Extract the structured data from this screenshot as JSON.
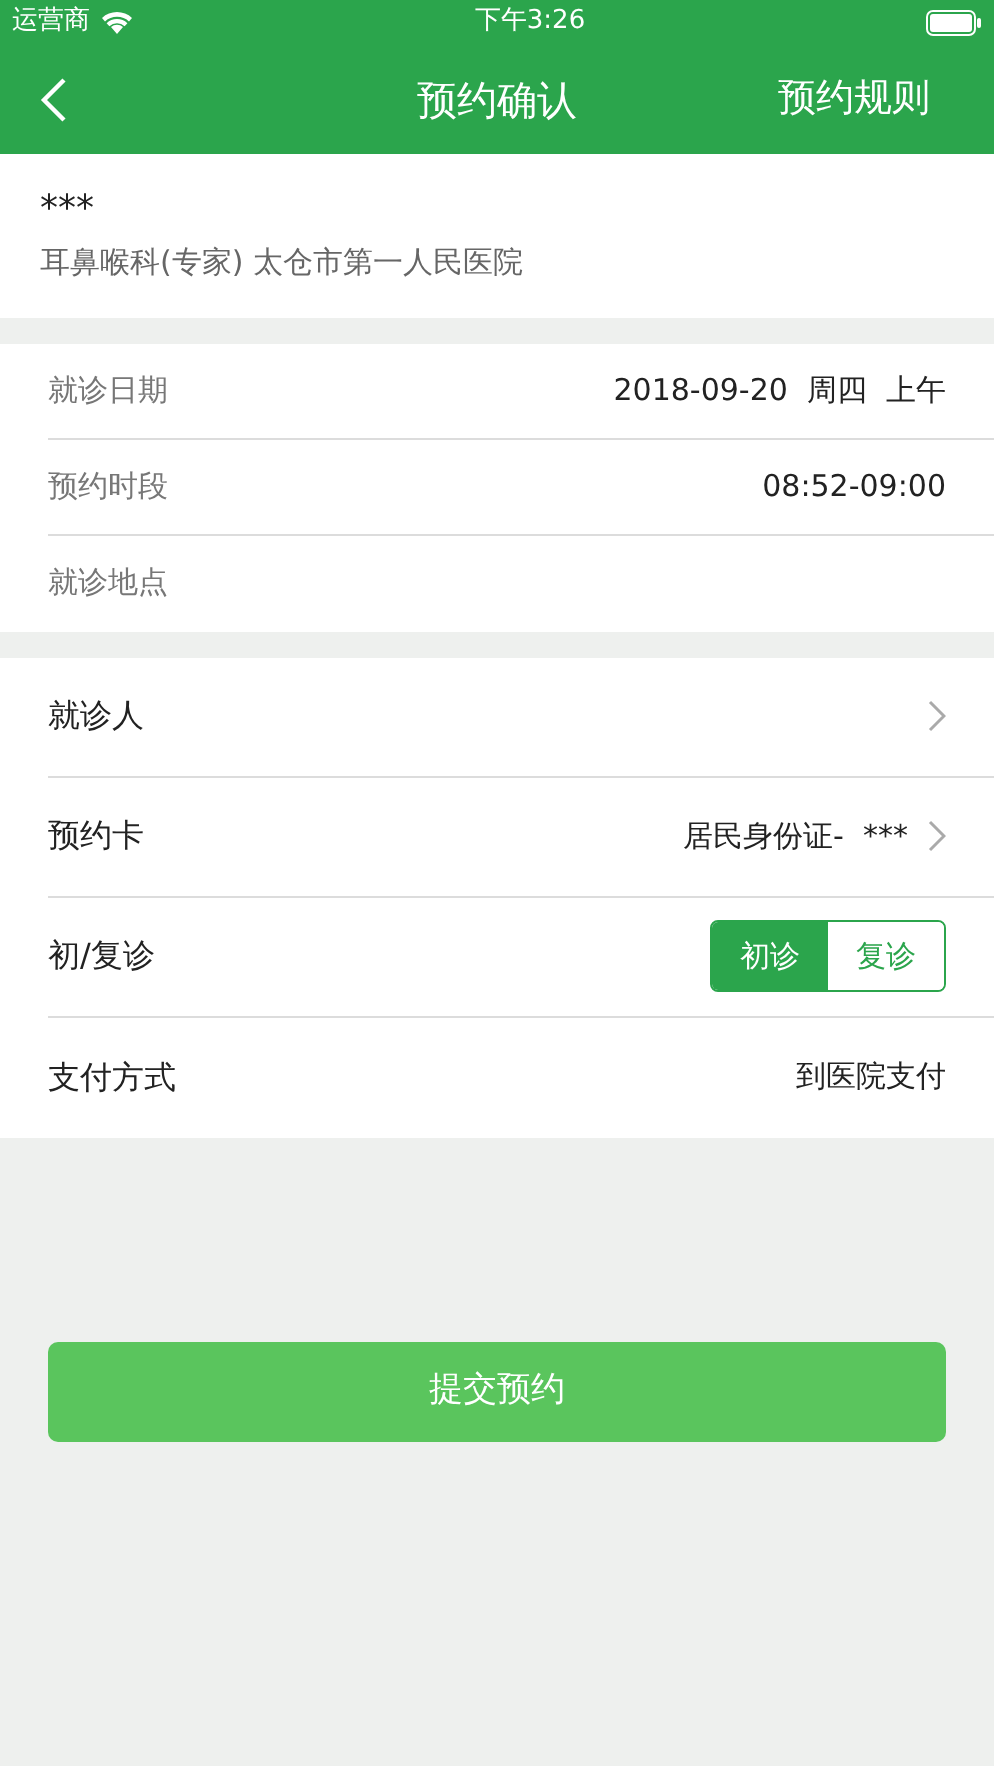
{
  "status_bar": {
    "carrier": "运营商",
    "time": "下午3:26"
  },
  "nav": {
    "title": "预约确认",
    "action": "预约规则"
  },
  "doctor": {
    "name": "***",
    "detail": "耳鼻喉科(专家) 太仓市第一人民医院"
  },
  "info_rows": [
    {
      "label": "就诊日期",
      "value": "2018-09-20  周四  上午"
    },
    {
      "label": "预约时段",
      "value": "08:52-09:00"
    },
    {
      "label": "就诊地点"
    }
  ],
  "form_rows": [
    {
      "kind": "link",
      "label": "就诊人"
    },
    {
      "kind": "link",
      "label": "预约卡",
      "value": "居民身份证-  ***"
    },
    {
      "kind": "segmented",
      "label": "初/复诊",
      "options": [
        {
          "label": "初诊",
          "selected": true
        },
        {
          "label": "复诊",
          "selected": false
        }
      ]
    },
    {
      "kind": "text",
      "label": "支付方式",
      "value": "到医院支付"
    }
  ],
  "submit": "提交预约"
}
